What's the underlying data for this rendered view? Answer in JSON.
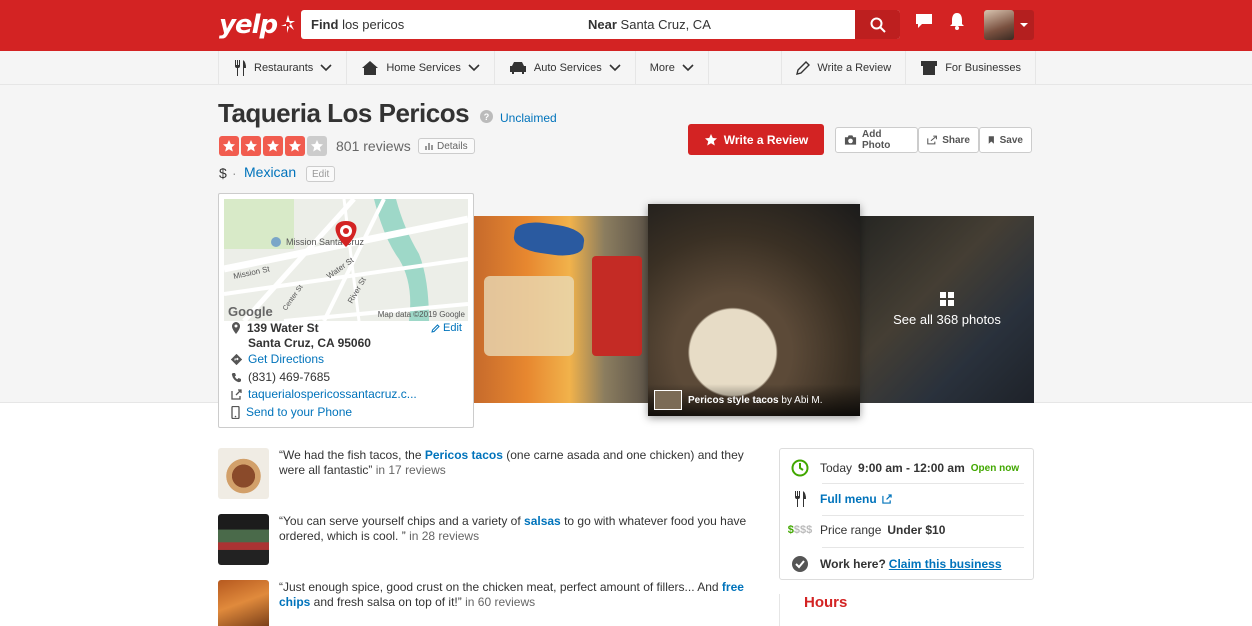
{
  "header": {
    "logo_text": "yelp",
    "search_find_label": "Find",
    "search_find_value": "los pericos",
    "search_near_label": "Near",
    "search_near_value": "Santa Cruz, CA"
  },
  "nav": {
    "items": [
      {
        "label": "Restaurants",
        "icon": "fork-knife-icon"
      },
      {
        "label": "Home Services",
        "icon": "house-icon"
      },
      {
        "label": "Auto Services",
        "icon": "car-icon"
      },
      {
        "label": "More",
        "icon": ""
      }
    ],
    "write_review": "Write a Review",
    "for_businesses": "For Businesses"
  },
  "business": {
    "name": "Taqueria Los Pericos",
    "unclaimed": "Unclaimed",
    "rating": 4,
    "reviews": "801 reviews",
    "details": "Details",
    "price": "$",
    "separator": "·",
    "category": "Mexican",
    "edit": "Edit"
  },
  "actions": {
    "write_review": "Write a Review",
    "add_photo": "Add Photo",
    "share": "Share",
    "save": "Save"
  },
  "map": {
    "labels": [
      "Mission Santa Cruz",
      "Mission St",
      "Water St",
      "River St",
      "Center St"
    ],
    "copyright": "Map data ©2019 Google",
    "google": "Google",
    "address_line1": "139 Water St",
    "address_line2": "Santa Cruz, CA 95060",
    "edit": "Edit",
    "directions": "Get Directions",
    "phone": "(831) 469-7685",
    "website": "taquerialospericossantacruz.c...",
    "send": "Send to your Phone"
  },
  "photos": {
    "caption_title": "Pericos style tacos",
    "caption_by": "by Abi M.",
    "see_all": "See all 368 photos"
  },
  "highlights": [
    {
      "pre": "“We had the fish tacos, the ",
      "link": "Pericos tacos",
      "post": " (one carne asada and one chicken) and they were all fantastic”",
      "count": " in 17 reviews"
    },
    {
      "pre": "“You can serve yourself chips and a variety of ",
      "link": "salsas",
      "post": " to go with whatever food you have ordered, which is cool. ”",
      "count": " in 28 reviews"
    },
    {
      "pre": "“Just enough spice, good crust on the chicken meat, perfect amount of fillers... And ",
      "link": "free chips",
      "post": " and fresh salsa on top of it!”",
      "count": " in 60 reviews"
    }
  ],
  "sidebar": {
    "today_label": "Today",
    "today_hours": "9:00 am - 12:00 am",
    "open_now": "Open now",
    "full_menu": "Full menu",
    "price_symbols_on": "$",
    "price_symbols_off": "$$$",
    "price_range_label": "Price range",
    "price_range_value": "Under $10",
    "work_here": "Work here?",
    "claim": "Claim this business",
    "hours_title": "Hours"
  },
  "colors": {
    "brand_red": "#d32323",
    "star_on": "#f15c4f",
    "star_off": "#cccccc",
    "link": "#0073bb",
    "open_green": "#41a700"
  }
}
